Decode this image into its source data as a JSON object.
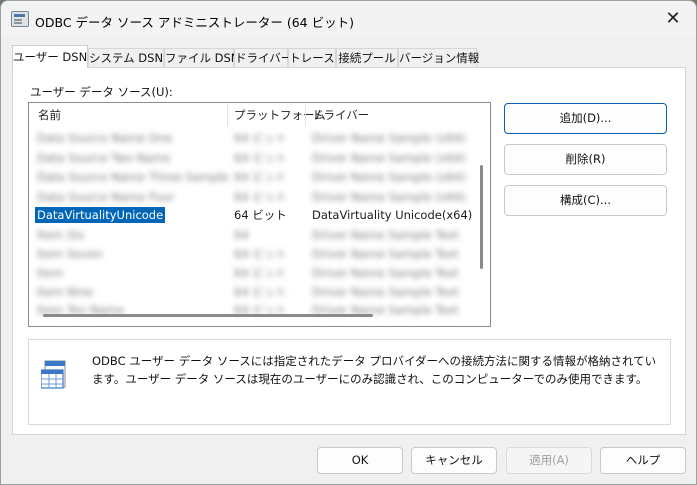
{
  "window": {
    "title": "ODBC データ ソース アドミニストレーター (64 ビット)",
    "close_glyph": "✕"
  },
  "tabs": [
    {
      "label": "ユーザー DSN",
      "active": true
    },
    {
      "label": "システム DSN"
    },
    {
      "label": "ファイル DSN"
    },
    {
      "label": "ドライバー"
    },
    {
      "label": "トレース"
    },
    {
      "label": "接続プール"
    },
    {
      "label": "バージョン情報"
    }
  ],
  "section_label": "ユーザー データ ソース(U):",
  "list": {
    "headers": {
      "name": "名前",
      "platform": "プラットフォーム",
      "driver": "ドライバー"
    },
    "rows": [
      {
        "name": "Data Source Name One",
        "platform": "64 ビット",
        "driver": "Driver Name Sample (x64)"
      },
      {
        "name": "Data Source Two Name",
        "platform": "64 ビット",
        "driver": "Driver Name Sample (x64)"
      },
      {
        "name": "Data Source Name Three Sample",
        "platform": "64 ビット",
        "driver": "Driver Name Sample (x64)"
      },
      {
        "name": "Data Source Name Four",
        "platform": "64 ビット",
        "driver": "Driver Name Sample (x64)"
      },
      {
        "name": "DataVirtualityUnicode",
        "platform": "64 ビット",
        "driver": "DataVirtuality Unicode(x64)",
        "selected": true
      },
      {
        "name": "Item Six",
        "platform": "64",
        "driver": "Driver Name Sample Text"
      },
      {
        "name": "Item Seven",
        "platform": "64 ビット",
        "driver": "Driver Name Sample Text"
      },
      {
        "name": "Item",
        "platform": "64 ビット",
        "driver": "Driver Name Sample Text"
      },
      {
        "name": "Item Nine",
        "platform": "64 ビット",
        "driver": "Driver Name Sample Text"
      },
      {
        "name": "Item Ten Name",
        "platform": "64 ビット",
        "driver": "Driver Name Sample Text"
      }
    ]
  },
  "buttons": {
    "add": "追加(D)...",
    "remove": "削除(R)",
    "configure": "構成(C)..."
  },
  "info": {
    "icon": "database-table-icon",
    "text": "ODBC ユーザー データ ソースには指定されたデータ プロバイダーへの接続方法に関する情報が格納されています。ユーザー データ ソースは現在のユーザーにのみ認識され、このコンピューターでのみ使用できます。"
  },
  "footer": {
    "ok": "OK",
    "cancel": "キャンセル",
    "apply": "適用(A)",
    "help": "ヘルプ"
  },
  "colors": {
    "selection": "#0066b8",
    "primary_border": "#0a5fb4"
  }
}
